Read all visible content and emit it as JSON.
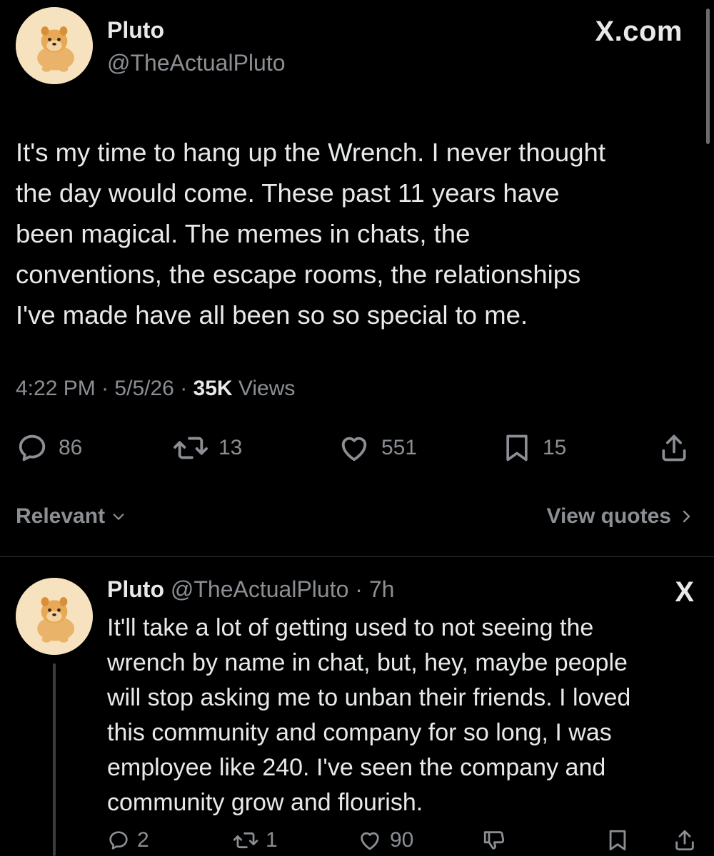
{
  "post": {
    "author_name": "Pluto",
    "author_handle": "@TheActualPluto",
    "avatar": "pomeranian-avatar",
    "brand": "X.com",
    "text": "It's my time to hang up the Wrench. I never thought\nthe day would come. These past 11 years have\nbeen magical. The memes in chats, the\nconventions, the escape rooms, the relationships\nI've made have all been so so special to me.",
    "time": "4:22 PM",
    "date": "5/5/26",
    "views_count": "35K",
    "views_label": "Views",
    "separator": "·",
    "actions": {
      "replies": "86",
      "reposts": "13",
      "likes": "551",
      "bookmarks": "15"
    },
    "icons": {
      "reply": "reply-icon",
      "repost": "repost-icon",
      "like": "heart-icon",
      "bookmark": "bookmark-icon",
      "share": "share-icon"
    }
  },
  "replies_bar": {
    "sort_label": "Relevant",
    "quotes_label": "View quotes"
  },
  "reply": {
    "author_name": "Pluto",
    "author_handle": "@TheActualPluto",
    "separator": "·",
    "time_ago": "7h",
    "brand_mark": "X",
    "text": "It'll take a lot of getting used to not seeing the\nwrench by name in chat, but, hey, maybe people\nwill stop asking me to unban their friends. I loved\nthis community and company for so long, I was\nemployee like 240. I've seen the company and\ncommunity grow and flourish.",
    "actions": {
      "replies": "2",
      "reposts": "1",
      "likes": "90"
    }
  },
  "colors": {
    "background": "#000000",
    "primary_text": "#e7e9ea",
    "secondary_text": "#8b8f93",
    "divider": "#2f3336",
    "avatar_bg": "#f6e2bf"
  }
}
